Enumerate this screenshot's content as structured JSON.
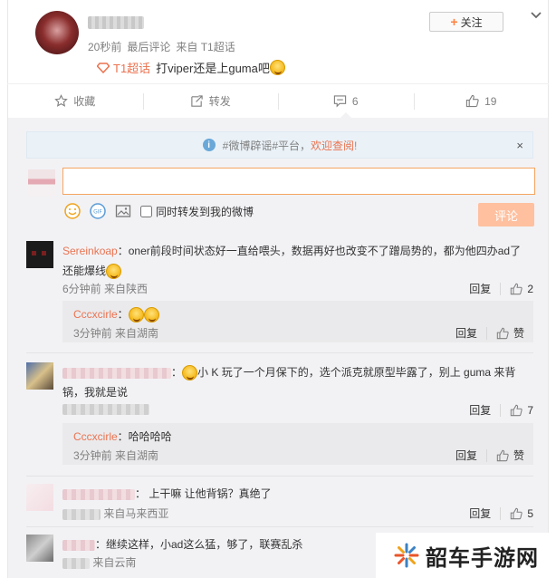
{
  "post": {
    "time": "20秒前",
    "last_comment": "最后评论",
    "source": "来自 T1超话",
    "topic_tag": "T1超话",
    "text": "打viper还是上guma吧",
    "follow_label": "关注",
    "actions": {
      "favorite": "收藏",
      "repost": "转发",
      "comment_count": "6",
      "like_count": "19"
    }
  },
  "notice": {
    "text": "#微博辟谣#平台，",
    "link": "欢迎查阅!",
    "close": "×"
  },
  "composer": {
    "input_value": "",
    "repost_checkbox_label": "同时转发到我的微博",
    "submit_label": "评论"
  },
  "ops": {
    "reply": "回复",
    "like_word": "赞"
  },
  "comments": [
    {
      "name": "Sereinkoap",
      "text": "：oner前段时间状态好一直给喂头，数据再好也改变不了蹭局势的，都为他四办ad了",
      "text_line2": "还能爆线",
      "meta": "6分钟前  来自陕西",
      "likes": "2"
    },
    {
      "reply_name": "Cccxcirle",
      "reply_text": "：",
      "reply_meta": "3分钟前  来自湖南"
    },
    {
      "text": "：",
      "text_rest": "小 K 玩了一个月保下的，选个派克就原型毕露了，别上 guma 来背",
      "text_line2": "锅，我就是说",
      "likes": "7"
    },
    {
      "reply_name": "Cccxcirle",
      "reply_text": "：哈哈哈哈",
      "reply_meta": "3分钟前  来自湖南"
    },
    {
      "text": "：  上干嘛 让他背锅？真绝了",
      "meta": "来自马来西亚",
      "likes": "5"
    },
    {
      "text": "：继续这样，小ad这么猛，够了，联赛乱杀",
      "meta": "来自云南"
    }
  ],
  "watermark": {
    "text": "韶车手游网"
  },
  "colors": {
    "accent": "#eb7350",
    "follow_plus": "#ff8140",
    "submit_bg": "#ffc09f",
    "comment_bg": "#f2f2f5"
  }
}
